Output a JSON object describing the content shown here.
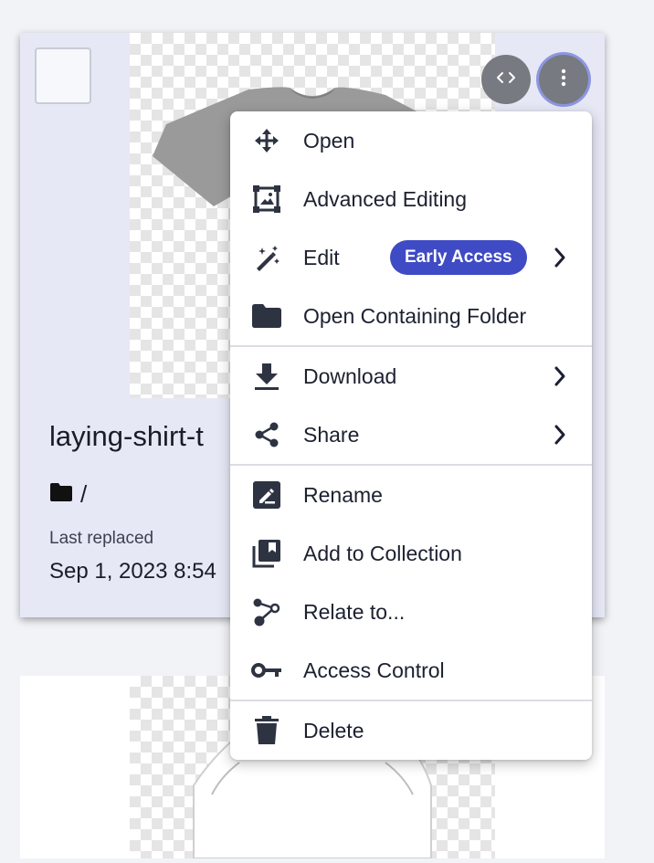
{
  "card": {
    "title": "laying-shirt-t",
    "folder_path": "/",
    "meta_label": "Last replaced",
    "meta_value": "Sep 1, 2023 8:54"
  },
  "buttons": {
    "embed_icon": "code-icon",
    "more_icon": "more-vertical-icon"
  },
  "menu": {
    "items": [
      {
        "label": "Open",
        "icon": "move-icon"
      },
      {
        "label": "Advanced Editing",
        "icon": "image-edit-icon"
      },
      {
        "label": "Edit",
        "icon": "magic-wand-icon",
        "badge": "Early Access",
        "submenu": true
      },
      {
        "label": "Open Containing Folder",
        "icon": "folder-icon"
      },
      {
        "label": "Download",
        "icon": "download-icon",
        "submenu": true
      },
      {
        "label": "Share",
        "icon": "share-icon",
        "submenu": true
      },
      {
        "label": "Rename",
        "icon": "rename-icon"
      },
      {
        "label": "Add to Collection",
        "icon": "collection-icon"
      },
      {
        "label": "Relate to...",
        "icon": "relation-icon"
      },
      {
        "label": "Access Control",
        "icon": "key-icon"
      },
      {
        "label": "Delete",
        "icon": "trash-icon"
      }
    ]
  },
  "colors": {
    "accent": "#3f4bc4",
    "card_selected_bg": "#e6e8f6",
    "icon": "#2e3342",
    "button_gray": "#777a80"
  }
}
